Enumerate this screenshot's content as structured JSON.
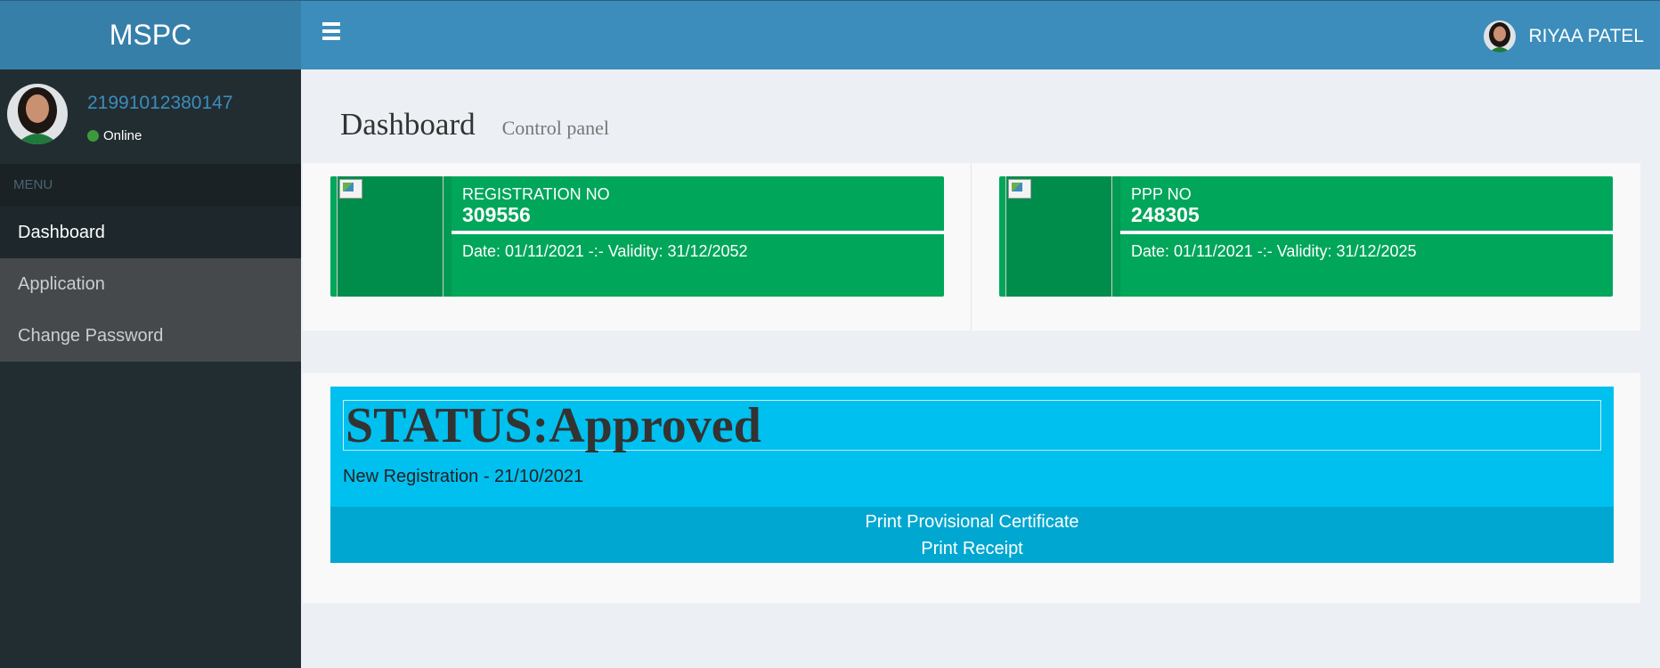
{
  "header": {
    "logo_text": "MSPC",
    "user_name": "RIYAA PATEL"
  },
  "sidebar": {
    "user_id": "21991012380147",
    "user_status": "Online",
    "menu_header": "MENU",
    "items": [
      {
        "label": "Dashboard"
      },
      {
        "label": "Application"
      },
      {
        "label": "Change Password"
      }
    ]
  },
  "content": {
    "title": "Dashboard",
    "subtitle": "Control panel"
  },
  "info_boxes": [
    {
      "label": "REGISTRATION NO",
      "number": "309556",
      "desc": "Date: 01/11/2021 -:- Validity: 31/12/2052"
    },
    {
      "label": "PPP NO",
      "number": "248305",
      "desc": "Date: 01/11/2021 -:- Validity: 31/12/2025"
    }
  ],
  "status": {
    "title": "STATUS:Approved",
    "subtitle": "New Registration - 21/10/2021",
    "links": [
      {
        "label": "Print Provisional Certificate"
      },
      {
        "label": "Print Receipt"
      }
    ]
  },
  "colors": {
    "navbar": "#3c8dbc",
    "logo": "#367fa9",
    "sidebar": "#222d32",
    "info_box": "#00a65a",
    "status_box": "#00c0ef",
    "online": "#3c9a3c"
  }
}
